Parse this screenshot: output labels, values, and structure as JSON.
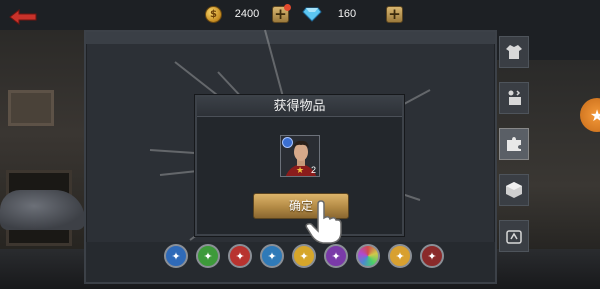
{
  "topbar": {
    "coins": "2400",
    "gems": "160",
    "coin_symbol": "$"
  },
  "dialog": {
    "title": "获得物品",
    "item_count": "2",
    "confirm_label": "确定"
  },
  "side_tabs": [
    {
      "icon": "shirt-icon"
    },
    {
      "icon": "figure-icon"
    },
    {
      "icon": "puzzle-icon",
      "active": true
    },
    {
      "icon": "box-icon"
    },
    {
      "icon": "dance-icon"
    }
  ],
  "faction_icons": [
    {
      "name": "faction-icon-1",
      "color": "#2f6ab8"
    },
    {
      "name": "faction-icon-2",
      "color": "#3d9a3a"
    },
    {
      "name": "faction-icon-3",
      "color": "#b8332f"
    },
    {
      "name": "faction-icon-4",
      "color": "#2f7ab8"
    },
    {
      "name": "faction-icon-5",
      "color": "#d6a62a"
    },
    {
      "name": "faction-icon-6",
      "color": "#7a3aa8"
    },
    {
      "name": "faction-icon-7",
      "color": "#d04a8a"
    },
    {
      "name": "faction-icon-8",
      "color": "#d8a030"
    },
    {
      "name": "faction-icon-9",
      "color": "#8a2a2a"
    }
  ],
  "colors": {
    "accent_gold": "#c9a056",
    "panel_bg": "#2c3036",
    "star_button": "#f59a3a"
  }
}
